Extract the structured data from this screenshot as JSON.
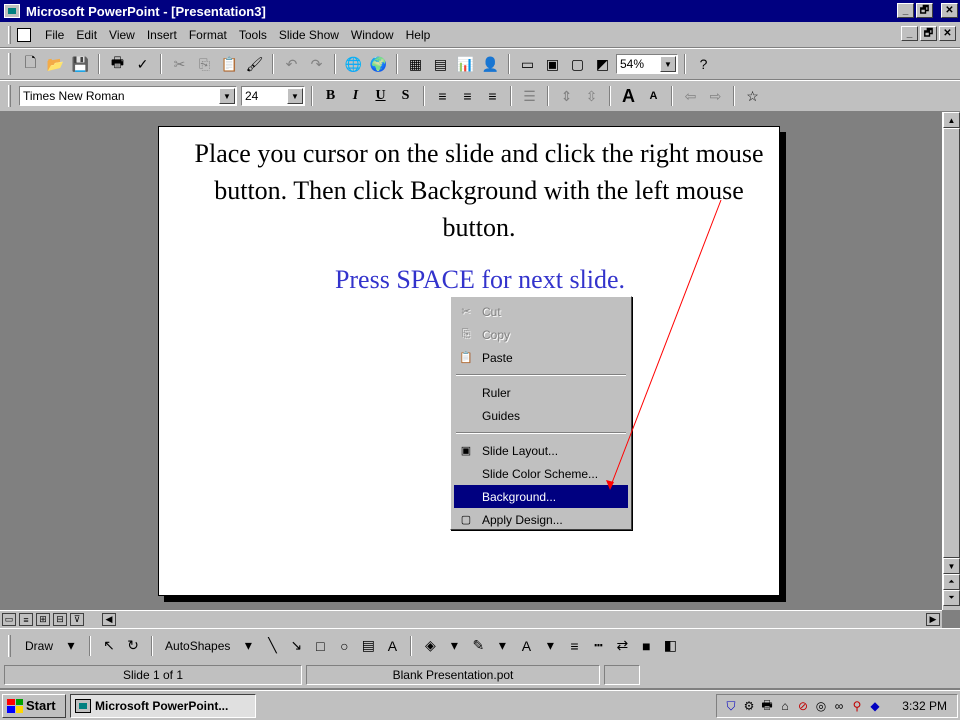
{
  "window": {
    "title": "Microsoft PowerPoint - [Presentation3]",
    "buttons": [
      "_",
      "🗗",
      "✕"
    ]
  },
  "menubar": {
    "items": [
      "File",
      "Edit",
      "View",
      "Insert",
      "Format",
      "Tools",
      "Slide Show",
      "Window",
      "Help"
    ]
  },
  "toolbar": {
    "zoom": "54%",
    "font_name": "Times New Roman",
    "font_size": "24"
  },
  "slide": {
    "instruction": "Place you cursor on the slide and click the right mouse button.  Then click Background with the left mouse button.",
    "hint": "Press SPACE for next slide.",
    "hint_color": "#3333cc"
  },
  "context_menu": {
    "items": [
      {
        "label": "Cut",
        "icon": "scissors-icon",
        "disabled": true
      },
      {
        "label": "Copy",
        "icon": "copy-icon",
        "disabled": true
      },
      {
        "label": "Paste",
        "icon": "paste-icon",
        "disabled": false
      },
      {
        "label": "Ruler",
        "icon": "",
        "disabled": false
      },
      {
        "label": "Guides",
        "icon": "",
        "disabled": false
      },
      {
        "label": "Slide Layout...",
        "icon": "slide-layout-icon",
        "disabled": false
      },
      {
        "label": "Slide Color Scheme...",
        "icon": "",
        "disabled": false
      },
      {
        "label": "Background...",
        "icon": "",
        "disabled": false,
        "highlighted": true
      },
      {
        "label": "Apply Design...",
        "icon": "apply-design-icon",
        "disabled": false
      }
    ]
  },
  "drawing_toolbar": {
    "draw_label": "Draw",
    "autoshapes_label": "AutoShapes"
  },
  "statusbar": {
    "slide_info": "Slide 1 of 1",
    "template": "Blank Presentation.pot"
  },
  "taskbar": {
    "start_label": "Start",
    "task_label": "Microsoft PowerPoint...",
    "clock": "3:32 PM"
  },
  "colors": {
    "title_bar": "#000080",
    "chrome": "#c0c0c0",
    "workspace": "#808080",
    "menu_highlight": "#000080",
    "pointer_line": "#ff0000"
  }
}
